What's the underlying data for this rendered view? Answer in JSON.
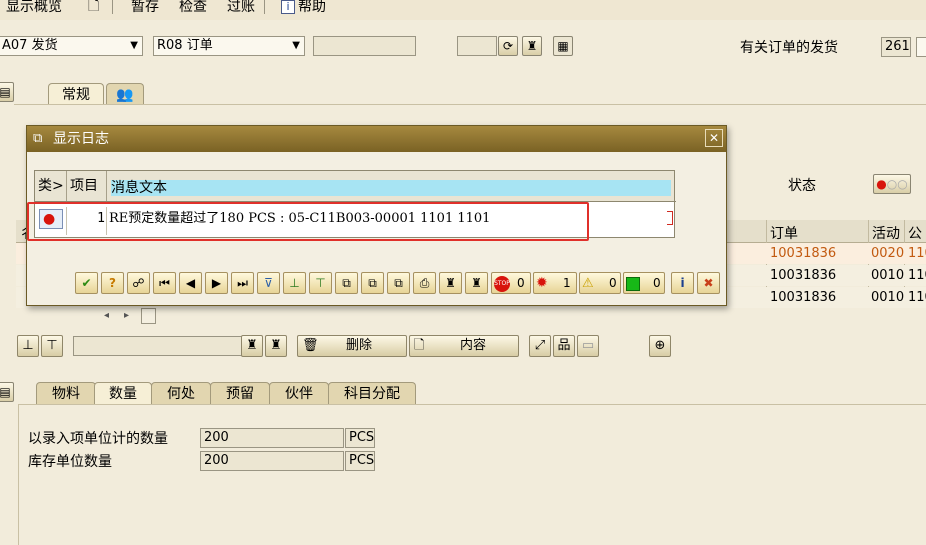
{
  "menu": {
    "display_overview": "显示概览",
    "hold": "暂存",
    "check": "检查",
    "post": "过账",
    "help": "帮助"
  },
  "header": {
    "movement_select": "A07 发货",
    "ref_select": "R08 订单",
    "ref_field": "",
    "small_field": "",
    "related_label": "有关订单的发货",
    "movement_type": "261"
  },
  "top_tabs": {
    "general": "常规"
  },
  "status_label": "状态",
  "orders_table": {
    "partial_header": "彳",
    "col_order": "订单",
    "col_activity": "活动",
    "col_plant_partial": "公",
    "rows": [
      {
        "order": "10031836",
        "activity": "0020",
        "plant": "110",
        "color": "#c25a10"
      },
      {
        "order": "10031836",
        "activity": "0010",
        "plant": "110",
        "color": "#000000"
      },
      {
        "order": "10031836",
        "activity": "0010",
        "plant": "110",
        "color": "#000000"
      }
    ]
  },
  "item_toolbar": {
    "search_field": "",
    "delete": "删除",
    "content": "内容"
  },
  "detail_tabs": [
    "物料",
    "数量",
    "何处",
    "预留",
    "伙伴",
    "科目分配"
  ],
  "quantity": {
    "entry_label": "以录入项单位计的数量",
    "entry_value": "200",
    "entry_unit": "PCS",
    "base_label": "库存单位数量",
    "base_value": "200",
    "base_unit": "PCS"
  },
  "dialog": {
    "title": "显示日志",
    "col_type": "类>",
    "col_item": "项目",
    "col_text": "消息文本",
    "rows": [
      {
        "item": "1",
        "text": "RE预定数量超过了180 PCS : 05-C11B003-00001 1101 1101"
      }
    ],
    "counts": {
      "stop": "0",
      "error": "1",
      "warning": "0",
      "success": "0"
    }
  },
  "colors": {
    "background": "#f2ecdb",
    "dialog_title": "#8a6f2c",
    "highlight_box": "#e0302a",
    "grid_header_accent": "#a7e4f3",
    "error_red": "#d8140c"
  }
}
